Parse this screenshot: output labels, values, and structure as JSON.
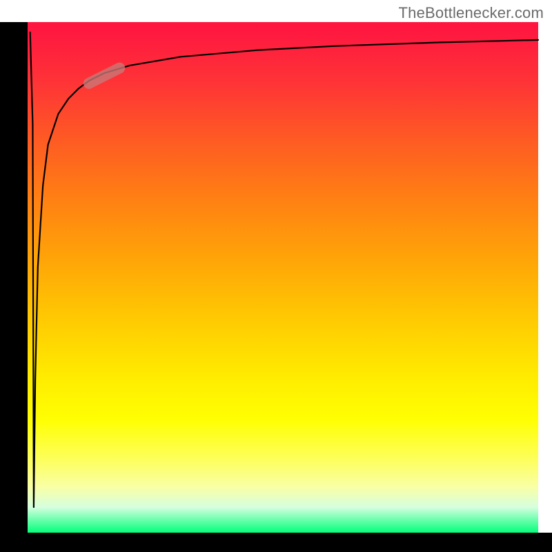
{
  "attribution": "TheBottlenecker.com",
  "colors": {
    "gradient_top": "#fe1440",
    "gradient_mid": "#ffed00",
    "gradient_bottom": "#03ff7c",
    "axis": "#000000",
    "curve": "#000000",
    "marker": "#c87a77",
    "attribution_text": "#6a6a6a"
  },
  "chart_data": {
    "type": "line",
    "title": "",
    "xlabel": "",
    "ylabel": "",
    "xlim": [
      0,
      100
    ],
    "ylim": [
      0,
      100
    ],
    "series": [
      {
        "name": "curve",
        "x": [
          0.5,
          1.0,
          1.2,
          1.5,
          2,
          3,
          4,
          6,
          8,
          10,
          12,
          15,
          20,
          30,
          45,
          60,
          80,
          100
        ],
        "y": [
          98,
          80,
          5,
          30,
          52,
          68,
          76,
          82,
          85,
          87,
          88.5,
          90,
          91.5,
          93.2,
          94.5,
          95.3,
          96.0,
          96.5
        ]
      }
    ],
    "annotations": [
      {
        "name": "highlight-segment",
        "x_range": [
          12,
          18
        ],
        "y_range": [
          88,
          91
        ],
        "note": "pink rounded marker on the curve near upper-left"
      }
    ],
    "grid": false,
    "legend": false
  }
}
